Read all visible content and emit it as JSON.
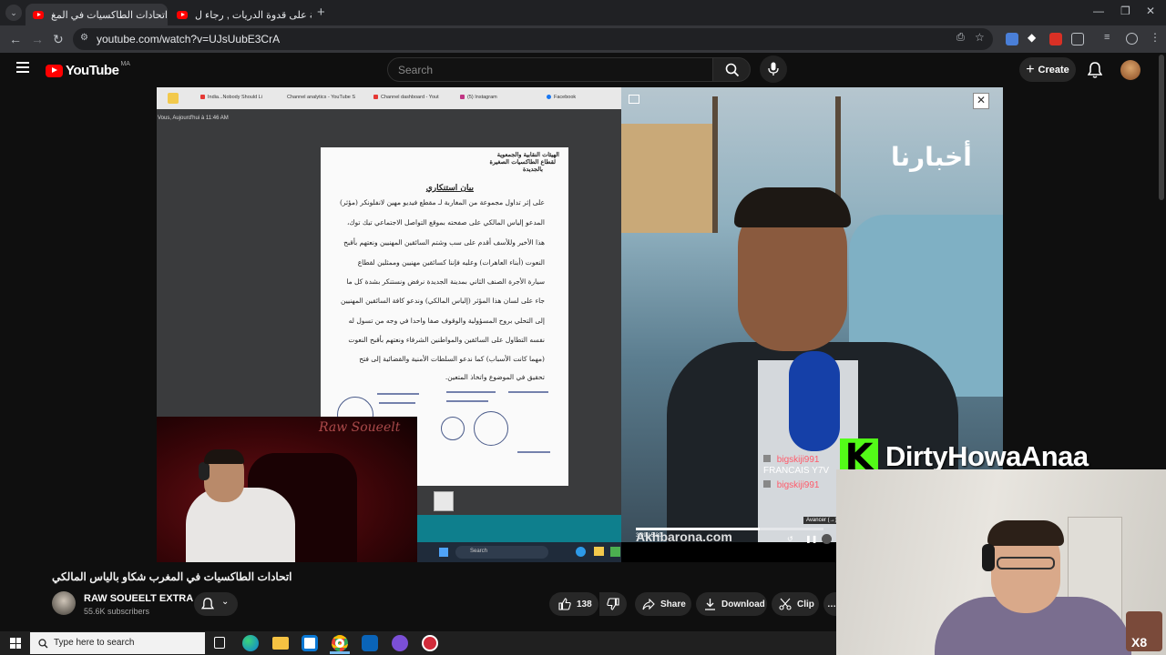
{
  "browser": {
    "tabs": [
      {
        "title": "اتحادات الطاكسيات في المغ",
        "active": true
      },
      {
        "title": "تطليعة على قدوة الدريات , رجاء ل",
        "active": false
      }
    ],
    "url": "youtube.com/watch?v=UJsUubE3CrA"
  },
  "youtube": {
    "logo_text": "YouTube",
    "country_code": "MA",
    "search_placeholder": "Search",
    "create_label": "Create"
  },
  "video": {
    "inner_browser_tabs": [
      "India...Nobody Should Li",
      "Channel analytics - YouTube S",
      "Channel dashboard - Yout",
      "(5) Instagram",
      "Facebook"
    ],
    "message_caption": "Vous, Aujourd'hui à 11:46 AM",
    "document": {
      "header_lines": [
        "الهيئات النقابية والجمعوية",
        "لقطاع الطاكسيات الصغيرة",
        "بالجديدة"
      ],
      "title": "بيان استنكاري",
      "lines": [
        "على إثر تداول مجموعة من المغاربة لـ مقطع فيديو مهين لانفلونكر (مؤثر)",
        "المدعو إلياس المالكي على صفحته بموقع التواصل الاجتماعي تيك توك،",
        "هذا الأخير وللأسف أقدم على سب وشتم السائقين المهنيين ونعتهم بأقبح",
        "النعوت (أبناء العاهرات) وعليه فإننا كسائقين مهنيين وممثلين لقطاع",
        "سيارة الأجرة الصنف الثاني بمدينة الجديدة نرفض ونستنكر بشدة كل ما",
        "جاء على لسان هذا المؤثر (إلياس المالكي) وندعو كافة السائقين المهنيين",
        "إلى التحلي بروح المسؤولية والوقوف صفا واحدا في وجه من تسول له",
        "نفسه التطاول على السائقين والمواطنين الشرفاء ونعتهم بأقبح النعوت",
        "(مهما كانت الأسباب) كما ندعو السلطات الأمنية والقضائية إلى فتح",
        "تحقيق في الموضوع واتخاذ المتعين."
      ]
    },
    "cam_brand": "Raw Soueelt",
    "inner_taskbar_search": "Search",
    "news_logo": "أخبارنا",
    "news_url": "Akhbarona.com",
    "news_time": "3:39 / 5:30",
    "tooltip": "Avancer (→)",
    "chat": [
      {
        "user": "bigskiji991",
        "text": ""
      },
      {
        "user": "",
        "text": "FRANCAIS Y7V"
      },
      {
        "user": "bigskiji991",
        "text": ""
      }
    ],
    "kick_letter": "K",
    "kick_username": "DirtyHowaAnaa",
    "cam2_badge": "X8"
  },
  "video_info": {
    "title": "اتحادات الطاكسيات في المغرب شكاو بالياس المالكي",
    "channel_name": "RAW SOUEELT EXTRA",
    "subscribers": "55.6K subscribers",
    "likes": "138",
    "share_label": "Share",
    "download_label": "Download",
    "clip_label": "Clip"
  },
  "taskbar": {
    "search_placeholder": "Type here to search"
  },
  "colors": {
    "youtube_red": "#ff0000",
    "kick_green": "#53fc18",
    "background": "#0f0f0f"
  }
}
